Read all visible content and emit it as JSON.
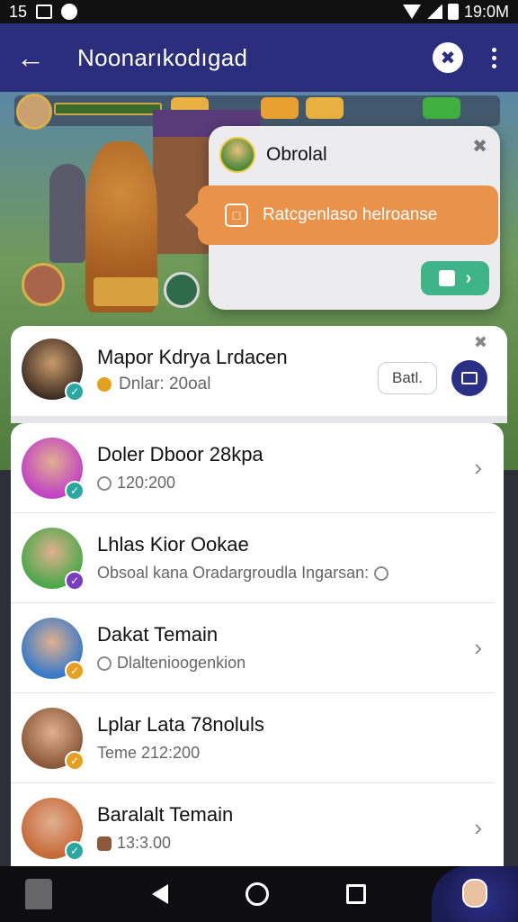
{
  "status_bar": {
    "time_left": "15",
    "time_right": "19:0M"
  },
  "app_bar": {
    "title": "Noonarıkodıgad",
    "back_icon": "back-arrow-icon",
    "tool_icon": "wrench-icon",
    "more_icon": "more-vert-icon"
  },
  "popup": {
    "name": "Obrolal",
    "banner_text": "Ratcgenlaso helroanse",
    "close_icon": "close-icon",
    "go_icon": "chevron-right-icon"
  },
  "pinned": {
    "title": "Mapor Kdrya Lrdacen",
    "subtitle": "Dnlar: 20oal",
    "button_label": "Batl.",
    "close_icon": "close-icon"
  },
  "list": {
    "items": [
      {
        "title": "Doler Dboor 28kpa",
        "subtitle": "120:200",
        "has_chevron": true,
        "avatar_color": "#c243c4",
        "badge_color": "#2aa7a0"
      },
      {
        "title": "Lhlas Kior Ookae",
        "subtitle": "Obsoal kana Oradargroudla Ingarsan:",
        "has_chevron": false,
        "avatar_color": "#4ca84a",
        "badge_color": "#7a3cc2"
      },
      {
        "title": "Dakat Temain",
        "subtitle": "Dlaltenioogenkion",
        "has_chevron": true,
        "avatar_color": "#3a7ac8",
        "badge_color": "#e6a020"
      },
      {
        "title": "Lplar Lata 78noluls",
        "subtitle": "Teme 212:200",
        "has_chevron": false,
        "avatar_color": "#8a5a3a",
        "badge_color": "#e6a020"
      },
      {
        "title": "Baralalt Temain",
        "subtitle": "13:3.00",
        "has_chevron": true,
        "avatar_color": "#c76a3a",
        "badge_color": "#2aa7a0"
      }
    ]
  },
  "colors": {
    "app_bar": "#2b2d7d",
    "accent_orange": "#e9934a",
    "accent_green": "#3fb38a",
    "dark_blue_button": "#2b3087"
  }
}
